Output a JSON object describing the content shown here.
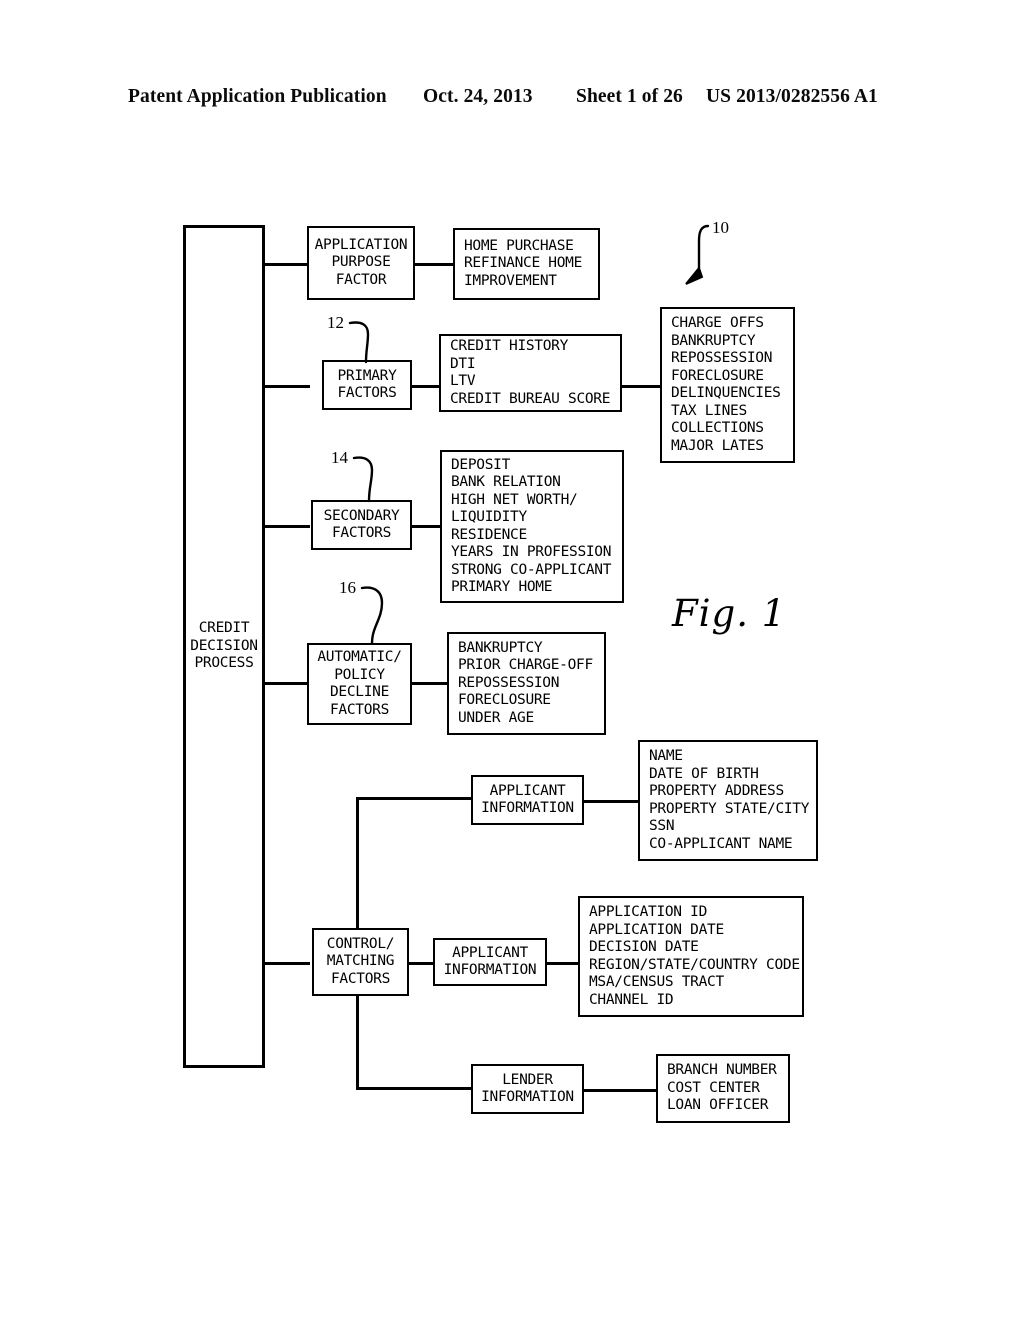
{
  "header": {
    "publication": "Patent Application Publication",
    "date": "Oct. 24, 2013",
    "sheet": "Sheet 1 of 26",
    "patent_number": "US 2013/0282556 A1"
  },
  "figure": {
    "caption": "Fig. 1",
    "reference_numerals": {
      "system": "10",
      "primary_factors": "12",
      "secondary_factors": "14",
      "automatic_policy_decline_factors": "16"
    }
  },
  "diagram": {
    "root": {
      "label_lines": [
        "CREDIT",
        "DECISION",
        "PROCESS"
      ]
    },
    "nodes": {
      "application_purpose_factor": {
        "label_lines": [
          "APPLICATION",
          "PURPOSE",
          "FACTOR"
        ]
      },
      "application_purpose_values": {
        "label_lines": [
          "HOME PURCHASE",
          "REFINANCE HOME",
          "IMPROVEMENT"
        ]
      },
      "primary_factors": {
        "label_lines": [
          "PRIMARY",
          "FACTORS"
        ]
      },
      "primary_factors_values": {
        "label_lines": [
          "CREDIT HISTORY",
          "DTI",
          "LTV",
          "CREDIT BUREAU SCORE"
        ]
      },
      "credit_history_detail": {
        "label_lines": [
          "CHARGE OFFS",
          "BANKRUPTCY",
          "REPOSSESSION",
          "FORECLOSURE",
          "DELINQUENCIES",
          "TAX LINES",
          "COLLECTIONS",
          "MAJOR LATES"
        ]
      },
      "secondary_factors": {
        "label_lines": [
          "SECONDARY",
          "FACTORS"
        ]
      },
      "secondary_factors_values": {
        "label_lines": [
          "DEPOSIT",
          "BANK RELATION",
          "HIGH NET WORTH/",
          "LIQUIDITY",
          "RESIDENCE",
          "YEARS IN PROFESSION",
          "STRONG CO-APPLICANT",
          "PRIMARY HOME"
        ]
      },
      "automatic_policy_decline_factors": {
        "label_lines": [
          "AUTOMATIC/",
          "POLICY",
          "DECLINE",
          "FACTORS"
        ]
      },
      "automatic_policy_decline_values": {
        "label_lines": [
          "BANKRUPTCY",
          "PRIOR CHARGE-OFF",
          "REPOSSESSION",
          "FORECLOSURE",
          "UNDER AGE"
        ]
      },
      "applicant_information_top": {
        "label_lines": [
          "APPLICANT",
          "INFORMATION"
        ]
      },
      "applicant_information_top_values": {
        "label_lines": [
          "NAME",
          "DATE OF BIRTH",
          "PROPERTY ADDRESS",
          "PROPERTY STATE/CITY",
          "SSN",
          "CO-APPLICANT NAME"
        ]
      },
      "control_matching_factors": {
        "label_lines": [
          "CONTROL/",
          "MATCHING",
          "FACTORS"
        ]
      },
      "applicant_information_mid": {
        "label_lines": [
          "APPLICANT",
          "INFORMATION"
        ]
      },
      "applicant_information_mid_values": {
        "label_lines": [
          "APPLICATION ID",
          "APPLICATION DATE",
          "DECISION DATE",
          "REGION/STATE/COUNTRY CODE",
          "MSA/CENSUS TRACT",
          "CHANNEL ID"
        ]
      },
      "lender_information": {
        "label_lines": [
          "LENDER",
          "INFORMATION"
        ]
      },
      "lender_information_values": {
        "label_lines": [
          "BRANCH NUMBER",
          "COST CENTER",
          "LOAN OFFICER"
        ]
      }
    }
  }
}
